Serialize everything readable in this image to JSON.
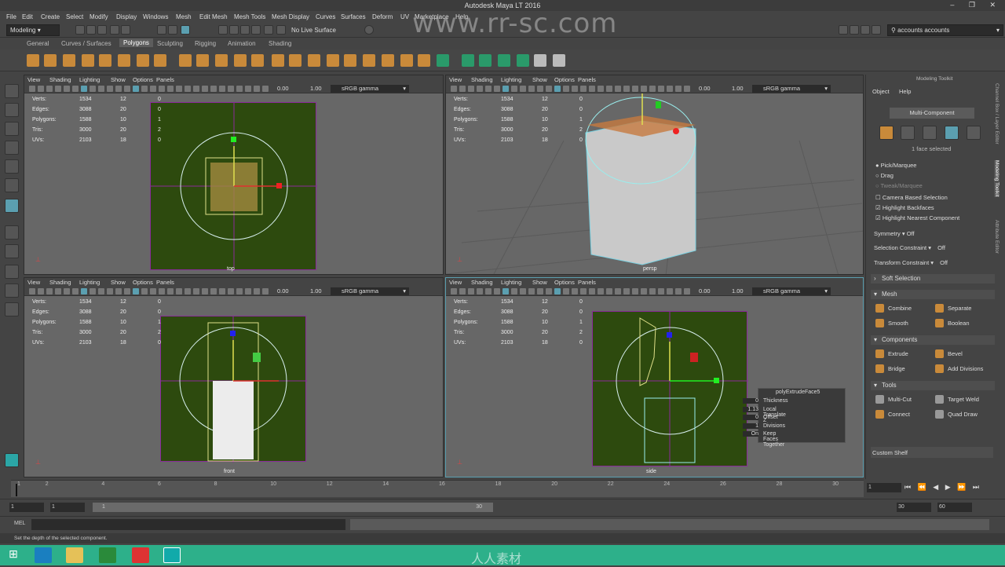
{
  "window": {
    "title": "Autodesk Maya LT 2016",
    "controls": "–  ❐  ✕"
  },
  "watermark": "www.rr-sc.com",
  "watermark_cn": "人人素材",
  "menu": [
    "File",
    "Edit",
    "Create",
    "Select",
    "Modify",
    "Display",
    "Windows",
    "Mesh",
    "Edit Mesh",
    "Mesh Tools",
    "Mesh Display",
    "Curves",
    "Surfaces",
    "Deform",
    "UV",
    "Marketplace",
    "Help"
  ],
  "status": {
    "mode": "Modeling",
    "live_surface": "No Live Surface",
    "account": "accounts accounts"
  },
  "shelf_tabs": [
    "General",
    "Curves / Surfaces",
    "Polygons",
    "Sculpting",
    "Rigging",
    "Animation",
    "Shading"
  ],
  "active_shelf": "Polygons",
  "viewport_menu": [
    "View",
    "Shading",
    "Lighting",
    "Show",
    "Options",
    "Panels"
  ],
  "viewport_fields": {
    "a": "0.00",
    "b": "1.00",
    "gamma": "sRGB gamma"
  },
  "hud": {
    "labels": [
      "Verts:",
      "Edges:",
      "Polygons:",
      "Tris:",
      "UVs:"
    ],
    "col1": [
      "1534",
      "3088",
      "1588",
      "3000",
      "2103"
    ],
    "col2": [
      "12",
      "20",
      "10",
      "20",
      "18"
    ],
    "col3": [
      "0",
      "0",
      "1",
      "2",
      "0"
    ]
  },
  "cameras": {
    "top": "top",
    "persp": "persp",
    "front": "front",
    "side": "side"
  },
  "extrude_hud": {
    "title": "polyExtrudeFace5",
    "rows": [
      {
        "label": "Thickness",
        "value": "0"
      },
      {
        "label": "Local Translate Z",
        "value": "1.13"
      },
      {
        "label": "Offset",
        "value": "0"
      },
      {
        "label": "Divisions",
        "value": "1"
      },
      {
        "label": "Keep Faces Together",
        "value": "On"
      }
    ]
  },
  "modeling_toolkit": {
    "title": "Modeling Toolkit",
    "menu": [
      "Object",
      "Help"
    ],
    "mode": "Multi-Component",
    "selected": "1 face selected",
    "options": [
      "Pick/Marquee",
      "Drag",
      "Tweak/Marquee"
    ],
    "checks": [
      "Camera Based Selection",
      "Highlight Backfaces",
      "Highlight Nearest Component"
    ],
    "symmetry": {
      "label": "Symmetry",
      "value": "Off"
    },
    "selection_constraint": {
      "label": "Selection Constraint",
      "value": "Off"
    },
    "transform_constraint": {
      "label": "Transform Constraint",
      "value": "Off"
    },
    "soft_selection": "Soft Selection",
    "sections": {
      "mesh": {
        "title": "Mesh",
        "buttons": [
          "Combine",
          "Separate",
          "Smooth",
          "Boolean"
        ]
      },
      "components": {
        "title": "Components",
        "buttons": [
          "Extrude",
          "Bevel",
          "Bridge",
          "Add Divisions"
        ]
      },
      "tools": {
        "title": "Tools",
        "buttons": [
          "Multi-Cut",
          "Target Weld",
          "Connect",
          "Quad Draw"
        ]
      }
    },
    "custom_shelf": "Custom Shelf"
  },
  "side_tabs": [
    "Channel Box / Layer Editor",
    "Modeling Toolkit",
    "Attribute Editor"
  ],
  "timeline": {
    "ticks": [
      "1",
      "2",
      "4",
      "6",
      "8",
      "10",
      "12",
      "14",
      "16",
      "18",
      "20",
      "22",
      "24",
      "26",
      "28",
      "30"
    ],
    "current": "1"
  },
  "range": {
    "start": "1",
    "start2": "1",
    "slider_start": "1",
    "slider_end": "30",
    "end": "30",
    "end2": "60"
  },
  "mel": "MEL",
  "help_line": "Set the depth of the selected component."
}
